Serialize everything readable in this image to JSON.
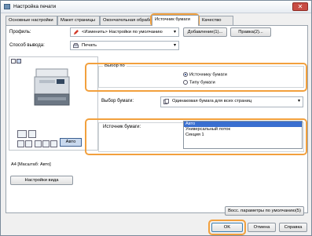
{
  "window": {
    "title": "Настройка печати",
    "close": "✕"
  },
  "tabs": [
    {
      "label": "Основные настройки"
    },
    {
      "label": "Макет страницы"
    },
    {
      "label": "Окончательная обработка"
    },
    {
      "label": "Источник бумаги"
    },
    {
      "label": "Качество"
    }
  ],
  "profile": {
    "label": "Профиль:",
    "value": "<Изменить> Настройки по умолчанию",
    "add_button": "Добавление(1)...",
    "edit_button": "Правка(2)..."
  },
  "output": {
    "label": "Способ вывода:",
    "value": "Печать"
  },
  "preview": {
    "auto_label": "Авто",
    "zoom_label": "A4 [Масштаб: Авто]",
    "view_settings_button": "Настройки вида"
  },
  "select_by": {
    "title": "Выбор по",
    "options": [
      {
        "label": "Источнику бумаги",
        "selected": true
      },
      {
        "label": "Типу бумаги",
        "selected": false
      }
    ]
  },
  "paper_selection": {
    "label": "Выбор бумаги:",
    "value": "Одинаковая бумага для всех страниц"
  },
  "paper_source": {
    "label": "Источник бумаги:",
    "items": [
      {
        "label": "Авто",
        "selected": true
      },
      {
        "label": "Универсальный лоток",
        "selected": false
      },
      {
        "label": "Секция 1",
        "selected": false
      }
    ]
  },
  "footer": {
    "restore_button": "Восс. параметры по умолчанию(5)",
    "ok_button": "OK",
    "cancel_button": "Отмена",
    "help_button": "Справка"
  },
  "colors": {
    "highlight": "#f2a03d",
    "selection": "#3a6fd0"
  }
}
